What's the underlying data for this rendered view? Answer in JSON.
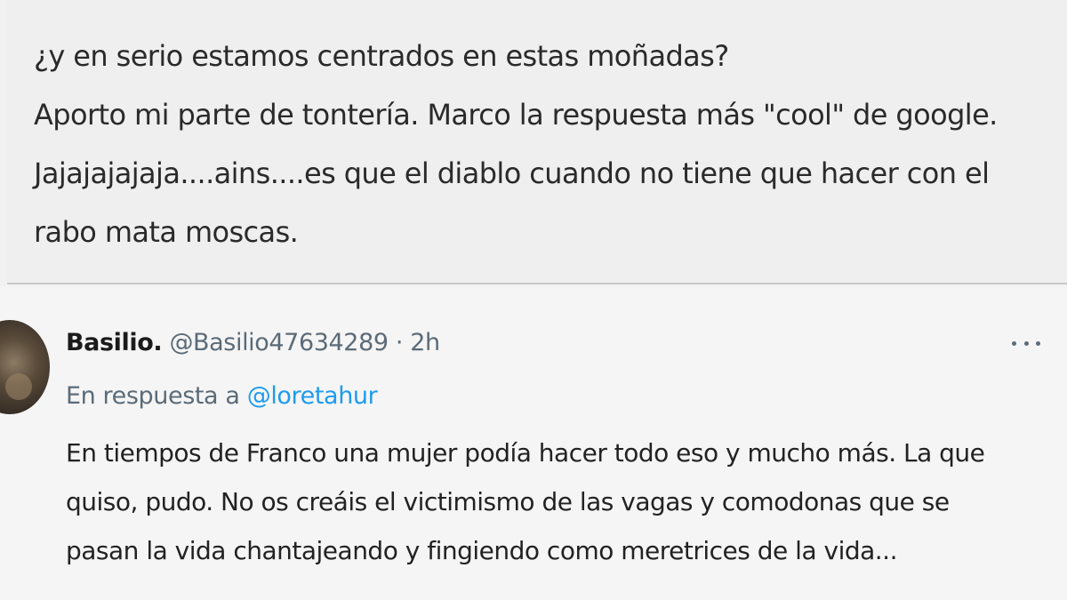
{
  "top_post": {
    "lines": [
      "¿y en serio estamos centrados en estas moñadas?",
      "Aporto mi parte de tontería. Marco la respuesta más \"cool\" de google.",
      "Jajajajajaja....ains....es que el diablo cuando no tiene que hacer con el",
      "rabo mata moscas."
    ]
  },
  "reply": {
    "author_name": "Basilio.",
    "author_handle": "@Basilio47634289",
    "separator": "·",
    "timestamp": "2h",
    "more_icon": "more-horizontal-icon",
    "in_reply_to_label": "En respuesta a",
    "in_reply_to_handle": "@loretahur",
    "text_lines": [
      "En tiempos de Franco una mujer podía hacer todo eso y mucho más. La que",
      "quiso, pudo. No os creáis el victimismo de las vagas y comodonas que se",
      "pasan la vida chantajeando y fingiendo como meretrices de la vida..."
    ]
  },
  "colors": {
    "link": "#1d9bf0",
    "secondary_text": "#5b6b78",
    "primary_text": "#1b1b1b"
  }
}
